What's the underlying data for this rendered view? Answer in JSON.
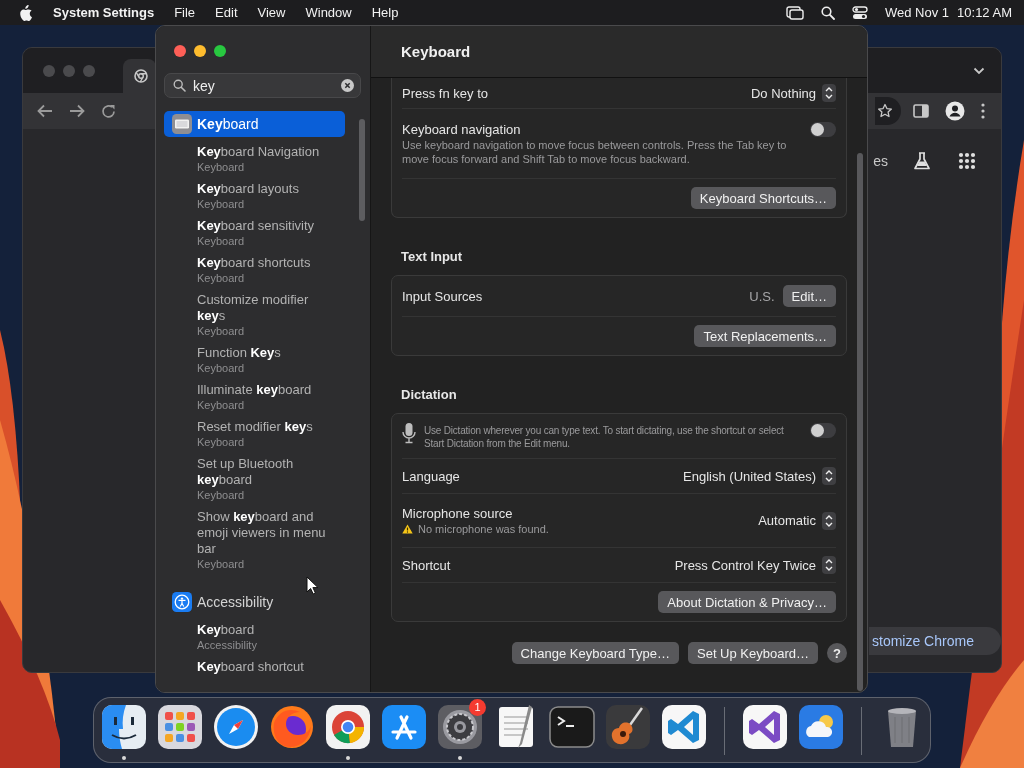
{
  "menu_bar": {
    "app_name": "System Settings",
    "menus": [
      "File",
      "Edit",
      "View",
      "Window",
      "Help"
    ],
    "date": "Wed Nov 1",
    "time": "10:12 AM"
  },
  "browser_window": {
    "page_text": "es",
    "customize_button": "stomize Chrome"
  },
  "settings_window": {
    "search": {
      "value": "key"
    },
    "results": [
      {
        "kind": "keyboard",
        "title": "**Key**board",
        "selected": true,
        "items": [
          {
            "title": "**Key**board Navigation",
            "subtitle": "Keyboard"
          },
          {
            "title": "**Key**board layouts",
            "subtitle": "Keyboard"
          },
          {
            "title": "**Key**board sensitivity",
            "subtitle": "Keyboard"
          },
          {
            "title": "**Key**board shortcuts",
            "subtitle": "Keyboard"
          },
          {
            "title": "Customize modifier **key**s",
            "subtitle": "Keyboard"
          },
          {
            "title": "Function **Key**s",
            "subtitle": "Keyboard"
          },
          {
            "title": "Illuminate **key**board",
            "subtitle": "Keyboard"
          },
          {
            "title": "Reset modifier **key**s",
            "subtitle": "Keyboard"
          },
          {
            "title": "Set up Bluetooth **key**board",
            "subtitle": "Keyboard"
          },
          {
            "title": "Show **key**board and emoji viewers in menu bar",
            "subtitle": "Keyboard"
          }
        ]
      },
      {
        "kind": "accessibility",
        "title": "Accessibility",
        "selected": false,
        "items": [
          {
            "title": "**Key**board",
            "subtitle": "Accessibility"
          },
          {
            "title": "**Key**board shortcut"
          }
        ]
      }
    ],
    "title": "Keyboard",
    "groups": [
      {
        "rows": [
          {
            "kind": "popup",
            "label": "Press fn key to",
            "value": "Do Nothing"
          },
          {
            "kind": "toggle",
            "label": "Keyboard navigation",
            "description": "Use keyboard navigation to move focus between controls. Press the Tab key to move focus forward and Shift Tab to move focus backward.",
            "on": false
          },
          {
            "kind": "buttons",
            "buttons": [
              "Keyboard Shortcuts…"
            ]
          }
        ]
      },
      {
        "heading": "Text Input",
        "rows": [
          {
            "kind": "value_button",
            "label": "Input Sources",
            "value": "U.S.",
            "button": "Edit…"
          },
          {
            "kind": "buttons",
            "buttons": [
              "Text Replacements…"
            ]
          }
        ]
      },
      {
        "heading": "Dictation",
        "rows": [
          {
            "kind": "mic_toggle",
            "description": "Use Dictation wherever you can type text. To start dictating, use the shortcut or select Start Dictation from the Edit menu.",
            "on": false
          },
          {
            "kind": "popup",
            "label": "Language",
            "value": "English (United States)"
          },
          {
            "kind": "popup",
            "label": "Microphone source",
            "value": "Automatic",
            "warning": "No microphone was found."
          },
          {
            "kind": "popup",
            "label": "Shortcut",
            "value": "Press Control Key Twice"
          },
          {
            "kind": "buttons",
            "buttons": [
              "About Dictation & Privacy…"
            ]
          }
        ]
      }
    ],
    "footer_buttons": [
      "Change Keyboard Type…",
      "Set Up Keyboard…"
    ],
    "help_button": "?"
  },
  "dock": {
    "items": [
      {
        "kind": "finder",
        "running": true
      },
      {
        "kind": "launchpad",
        "running": false
      },
      {
        "kind": "safari",
        "running": false
      },
      {
        "kind": "firefox",
        "running": false
      },
      {
        "kind": "chrome",
        "running": true
      },
      {
        "kind": "appstore",
        "running": false
      },
      {
        "kind": "settings",
        "running": true,
        "badge": "1"
      },
      {
        "kind": "textedit",
        "running": false
      },
      {
        "kind": "terminal",
        "running": false
      },
      {
        "kind": "garageband",
        "running": false
      },
      {
        "kind": "vscode",
        "running": false
      },
      {
        "kind": "separator"
      },
      {
        "kind": "visualstudio",
        "running": false
      },
      {
        "kind": "weather",
        "running": false
      },
      {
        "kind": "separator"
      },
      {
        "kind": "trash",
        "running": false
      }
    ]
  }
}
